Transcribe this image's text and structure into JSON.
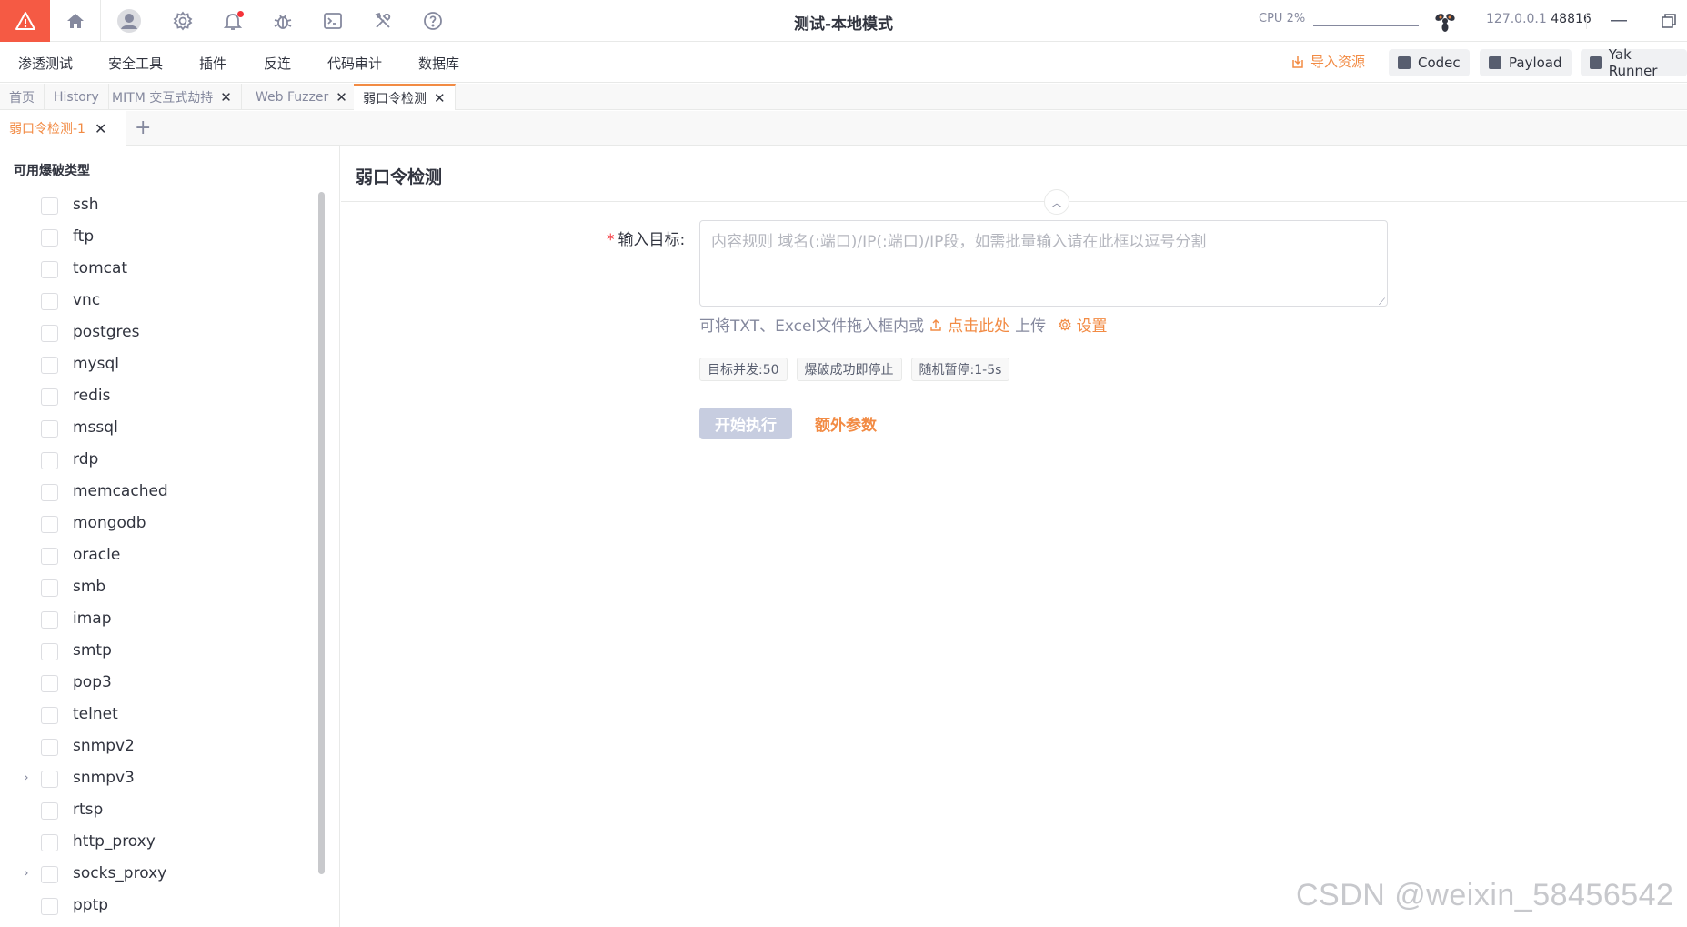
{
  "window": {
    "title": "测试-本地模式",
    "cpu_label": "CPU 2%",
    "host": "127.0.0.1",
    "port": "48816"
  },
  "topbar": {
    "icons": [
      "warning-icon",
      "home-icon",
      "user-avatar-icon",
      "settings-icon",
      "bell-icon",
      "bug-icon",
      "terminal-icon",
      "tools-icon",
      "help-icon"
    ]
  },
  "menu": {
    "items": [
      "渗透测试",
      "安全工具",
      "插件",
      "反连",
      "代码审计",
      "数据库"
    ],
    "import_label": "导入资源",
    "codec_label": "Codec",
    "payload_label": "Payload",
    "yakrunner_label": "Yak Runner"
  },
  "tabs": [
    {
      "label": "首页",
      "closable": false
    },
    {
      "label": "History",
      "closable": false
    },
    {
      "label": "MITM 交互式劫持",
      "closable": true
    },
    {
      "label": "Web Fuzzer",
      "closable": true
    },
    {
      "label": "弱口令检测",
      "closable": true,
      "active": true
    }
  ],
  "subtab": {
    "label": "弱口令检测-1",
    "add_label": "+"
  },
  "sidebar": {
    "title": "可用爆破类型",
    "items": [
      {
        "label": "ssh"
      },
      {
        "label": "ftp"
      },
      {
        "label": "tomcat"
      },
      {
        "label": "vnc"
      },
      {
        "label": "postgres"
      },
      {
        "label": "mysql"
      },
      {
        "label": "redis"
      },
      {
        "label": "mssql"
      },
      {
        "label": "rdp"
      },
      {
        "label": "memcached"
      },
      {
        "label": "mongodb"
      },
      {
        "label": "oracle"
      },
      {
        "label": "smb"
      },
      {
        "label": "imap"
      },
      {
        "label": "smtp"
      },
      {
        "label": "pop3"
      },
      {
        "label": "telnet"
      },
      {
        "label": "snmpv2"
      },
      {
        "label": "snmpv3",
        "expandable": true
      },
      {
        "label": "rtsp"
      },
      {
        "label": "http_proxy"
      },
      {
        "label": "socks_proxy",
        "expandable": true
      },
      {
        "label": "pptp"
      }
    ]
  },
  "main": {
    "title": "弱口令检测",
    "target_label": "输入目标:",
    "required_mark": "*",
    "target_placeholder": "内容规则 域名(:端口)/IP(:端口)/IP段，如需批量输入请在此框以逗号分割",
    "hint_prefix": "可将TXT、Excel文件拖入框内或",
    "hint_link": "点击此处",
    "hint_suffix": "上传",
    "settings_link": "设置",
    "tags": [
      "目标并发:50",
      "爆破成功即停止",
      "随机暂停:1-5s"
    ],
    "start_button": "开始执行",
    "extra_params": "额外参数"
  },
  "watermark": "CSDN @weixin_58456542",
  "colors": {
    "accent": "#f28b44",
    "logo_bg": "#f55a44",
    "disabled_btn": "#c7cde0"
  }
}
